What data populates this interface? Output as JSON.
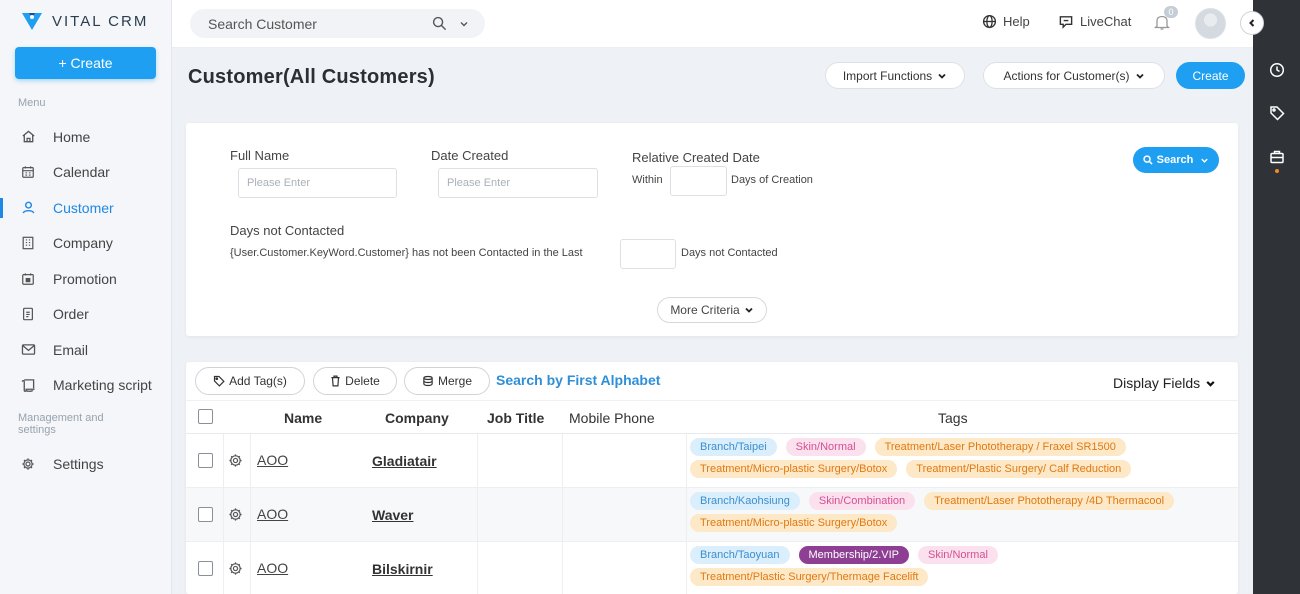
{
  "app": {
    "logo_text": "VITAL CRM",
    "create_label": "+ Create",
    "menu_title": "Menu",
    "nav": [
      {
        "label": "Home",
        "icon": "home-icon"
      },
      {
        "label": "Calendar",
        "icon": "calendar-icon"
      },
      {
        "label": "Customer",
        "icon": "user-icon",
        "active": true
      },
      {
        "label": "Company",
        "icon": "building-icon"
      },
      {
        "label": "Promotion",
        "icon": "promotion-icon"
      },
      {
        "label": "Order",
        "icon": "order-icon"
      },
      {
        "label": "Email",
        "icon": "mail-icon"
      },
      {
        "label": "Marketing script",
        "icon": "script-icon"
      }
    ],
    "management_title": "Management and settings",
    "settings_label": "Settings",
    "accent_color": "#1e9ff2"
  },
  "topbar": {
    "search_placeholder": "Search Customer",
    "help_label": "Help",
    "livechat_label": "LiveChat",
    "notification_count": "0"
  },
  "page": {
    "title": "Customer(All Customers)",
    "import_label": "Import Functions",
    "actions_label": "Actions for Customer(s)",
    "create_label": "Create"
  },
  "filters": {
    "full_name_label": "Full Name",
    "full_name_placeholder": "Please Enter",
    "date_created_label": "Date Created",
    "date_created_placeholder": "Please Enter",
    "relative_label": "Relative Created Date",
    "within_label": "Within",
    "days_creation_label": "Days of Creation",
    "not_contacted_label": "Days not Contacted",
    "not_contacted_text": "{User.Customer.KeyWord.Customer} has not been Contacted in the Last",
    "days_not_contacted_label": "Days not Contacted",
    "search_label": "Search",
    "more_criteria_label": "More Criteria"
  },
  "table": {
    "add_tag_label": "Add Tag(s)",
    "delete_label": "Delete",
    "merge_label": "Merge",
    "alphabet_label": "Search by First Alphabet",
    "display_fields_label": "Display Fields",
    "columns": {
      "name": "Name",
      "company": "Company",
      "job_title": "Job Title",
      "mobile": "Mobile Phone",
      "tags": "Tags"
    },
    "rows": [
      {
        "name": "AOO",
        "company": "Gladiatair",
        "tags": [
          {
            "text": "Branch/Taipei",
            "color": "blue"
          },
          {
            "text": "Skin/Normal",
            "color": "pink"
          },
          {
            "text": "Treatment/Laser Phototherapy / Fraxel SR1500",
            "color": "orange"
          },
          {
            "text": "Treatment/Micro-plastic Surgery/Botox",
            "color": "orange"
          },
          {
            "text": "Treatment/Plastic Surgery/ Calf Reduction",
            "color": "orange"
          }
        ]
      },
      {
        "name": "AOO",
        "company": "Waver",
        "tags": [
          {
            "text": "Branch/Kaohsiung",
            "color": "blue"
          },
          {
            "text": "Skin/Combination",
            "color": "pink"
          },
          {
            "text": "Treatment/Laser Phototherapy /4D Thermacool",
            "color": "orange"
          },
          {
            "text": "Treatment/Micro-plastic Surgery/Botox",
            "color": "orange"
          }
        ]
      },
      {
        "name": "AOO",
        "company": "Bilskirnir",
        "tags": [
          {
            "text": "Branch/Taoyuan",
            "color": "blue"
          },
          {
            "text": "Membership/2.VIP",
            "color": "purple"
          },
          {
            "text": "Skin/Normal",
            "color": "pink"
          },
          {
            "text": "Treatment/Plastic Surgery/Thermage Facelift",
            "color": "orange"
          }
        ]
      }
    ]
  }
}
